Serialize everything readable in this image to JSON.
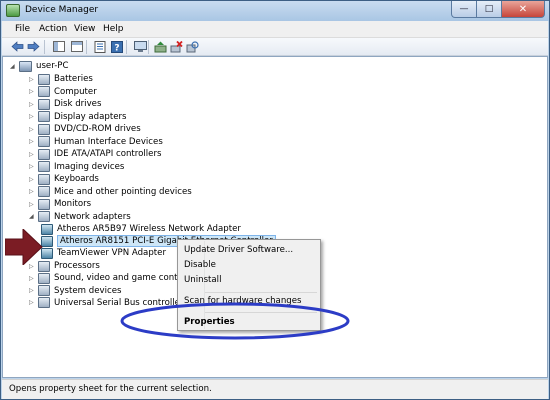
{
  "window": {
    "title": "Device Manager",
    "minimize_glyph": "—",
    "maximize_glyph": "□",
    "close_glyph": "✕"
  },
  "menubar": [
    {
      "label": "File"
    },
    {
      "label": "Action"
    },
    {
      "label": "View"
    },
    {
      "label": "Help"
    }
  ],
  "toolbar": {
    "icons": [
      "back-icon",
      "forward-icon",
      "show-hide-console-tree-icon",
      "properties-icon",
      "help-icon",
      "display-icon",
      "update-driver-icon",
      "uninstall-icon",
      "scan-hardware-icon"
    ]
  },
  "tree": {
    "root": "user-PC",
    "categories": [
      "Batteries",
      "Computer",
      "Disk drives",
      "Display adapters",
      "DVD/CD-ROM drives",
      "Human Interface Devices",
      "IDE ATA/ATAPI controllers",
      "Imaging devices",
      "Keyboards",
      "Mice and other pointing devices",
      "Monitors",
      "Network adapters"
    ],
    "network_children": [
      "Atheros AR5B97 Wireless Network Adapter",
      "Atheros AR8151 PCI-E Gigabit Ethernet Controller",
      "TeamViewer VPN Adapter"
    ],
    "after_categories": [
      "Processors",
      "Sound, video and game controllers",
      "System devices",
      "Universal Serial Bus controllers"
    ]
  },
  "context_menu": {
    "items": [
      "Update Driver Software...",
      "Disable",
      "Uninstall",
      "Scan for hardware changes",
      "Properties"
    ],
    "default_item": "Properties"
  },
  "status": {
    "text": "Opens property sheet for the current selection."
  },
  "colors": {
    "arrow": "#7b1c24",
    "highlight_ellipse": "#2c3cc6",
    "selection": "#cde6f7"
  }
}
